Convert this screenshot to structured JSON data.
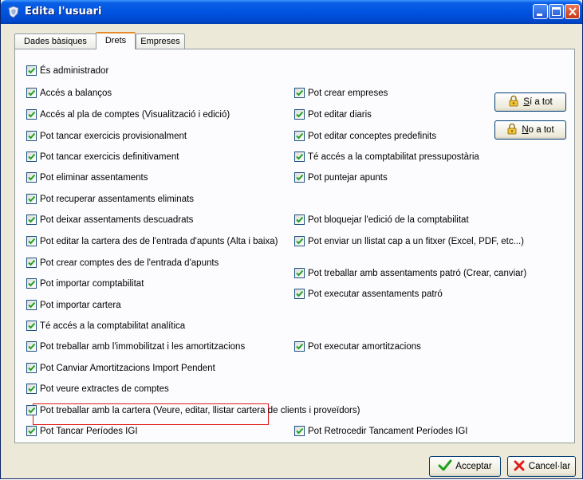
{
  "window": {
    "title": "Edita l'usuari"
  },
  "tabs": [
    {
      "label": "Dades bàsiques"
    },
    {
      "label": "Drets"
    },
    {
      "label": "Empreses"
    }
  ],
  "permissions": {
    "left": [
      {
        "label": "És administrador",
        "checked": true
      },
      {
        "label": "Accés a balanços",
        "checked": true
      },
      {
        "label": "Accés al pla de comptes (Visualització i edició)",
        "checked": true
      },
      {
        "label": "Pot tancar exercicis provisionalment",
        "checked": true
      },
      {
        "label": "Pot tancar exercicis definitivament",
        "checked": true
      },
      {
        "label": "Pot eliminar assentaments",
        "checked": true
      },
      {
        "label": "Pot recuperar assentaments eliminats",
        "checked": true
      },
      {
        "label": "Pot deixar assentaments descuadrats",
        "checked": true
      },
      {
        "label": "Pot editar la cartera des de l'entrada d'apunts (Alta i baixa)",
        "checked": true
      },
      {
        "label": "Pot crear comptes des de l'entrada d'apunts",
        "checked": true
      },
      {
        "label": "Pot importar comptabilitat",
        "checked": true
      },
      {
        "label": "Pot importar cartera",
        "checked": true
      },
      {
        "label": "Té accés a la comptabilitat analítica",
        "checked": true
      },
      {
        "label": "Pot treballar amb l'immobilitzat i les amortitzacions",
        "checked": true
      },
      {
        "label": "Pot Canviar Amortitzacions Import Pendent",
        "checked": true
      },
      {
        "label": "Pot veure extractes de comptes",
        "checked": true
      },
      {
        "label": "Pot treballar amb la cartera (Veure, editar, llistar cartera de clients i proveïdors)",
        "checked": true
      },
      {
        "label": "Pot Tancar Períodes IGI",
        "checked": true
      }
    ],
    "right": [
      {
        "label": "Pot crear empreses",
        "checked": true
      },
      {
        "label": "Pot editar diaris",
        "checked": true
      },
      {
        "label": "Pot editar conceptes predefinits",
        "checked": true
      },
      {
        "label": "Té accés a la comptabilitat pressupostària",
        "checked": true
      },
      {
        "label": "Pot puntejar apunts",
        "checked": true
      },
      {
        "label": "Pot bloquejar l'edició de la comptabilitat",
        "checked": true
      },
      {
        "label": "Pot enviar un llistat cap a un fitxer (Excel, PDF, etc...)",
        "checked": true
      },
      {
        "label": "Pot treballar amb assentaments patró (Crear, canviar)",
        "checked": true
      },
      {
        "label": "Pot executar assentaments patró",
        "checked": true
      },
      {
        "label": "Pot executar amortitzacions",
        "checked": true
      },
      {
        "label": "Pot Retrocedir Tancament Períodes IGI",
        "checked": true
      }
    ]
  },
  "side_buttons": {
    "yes_all": {
      "key": "S",
      "rest": "í a tot"
    },
    "no_all": {
      "key": "N",
      "rest": "o a tot"
    }
  },
  "footer": {
    "accept_label": "Acceptar",
    "cancel_label": "Cancel·lar"
  },
  "colors": {
    "accent": "#0053e0",
    "highlight": "#e21c1c",
    "check": "#21a121"
  }
}
